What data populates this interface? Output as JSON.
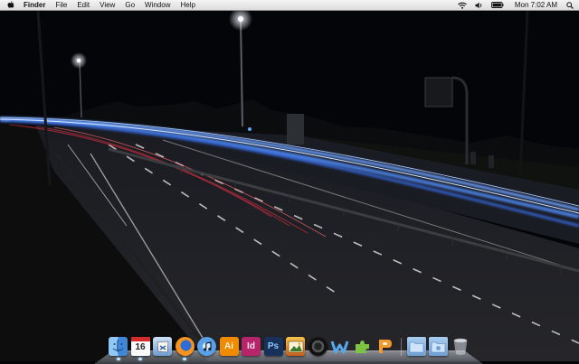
{
  "menubar": {
    "app_name": "Finder",
    "menus": [
      "File",
      "Edit",
      "View",
      "Go",
      "Window",
      "Help"
    ],
    "clock": "Mon 7:02 AM",
    "status_icons": [
      "wifi-icon",
      "volume-icon",
      "battery-icon",
      "spotlight-icon"
    ]
  },
  "dock": {
    "apps": [
      {
        "name": "finder",
        "icon": "finder-icon",
        "running": true
      },
      {
        "name": "ical",
        "icon": "calendar-icon",
        "label": "16",
        "running": true
      },
      {
        "name": "mail",
        "icon": "mail-icon",
        "running": false
      },
      {
        "name": "firefox",
        "icon": "firefox-icon",
        "running": true
      },
      {
        "name": "itunes",
        "icon": "itunes-icon",
        "running": false
      },
      {
        "name": "illustrator",
        "icon": "illustrator-icon",
        "label": "Ai",
        "running": false
      },
      {
        "name": "indesign",
        "icon": "indesign-icon",
        "label": "Id",
        "running": false
      },
      {
        "name": "photoshop",
        "icon": "photoshop-icon",
        "label": "Ps",
        "running": false
      },
      {
        "name": "iphoto",
        "icon": "iphoto-icon",
        "running": false
      },
      {
        "name": "aperture",
        "icon": "aperture-icon",
        "running": false
      },
      {
        "name": "web",
        "icon": "web-icon",
        "running": false
      },
      {
        "name": "puzzle",
        "icon": "puzzle-icon",
        "running": false
      },
      {
        "name": "pages",
        "icon": "pages-icon",
        "running": false
      }
    ],
    "stacks": [
      {
        "name": "applications-folder",
        "icon": "folder-icon"
      },
      {
        "name": "downloads-folder",
        "icon": "folder-icon"
      },
      {
        "name": "trash",
        "icon": "trash-icon"
      }
    ]
  },
  "colors": {
    "menubar_bg": "#e6e6e6",
    "light_trail_blue": "#6aa0ff",
    "light_trail_red": "#d83040",
    "sky": "#040509"
  }
}
